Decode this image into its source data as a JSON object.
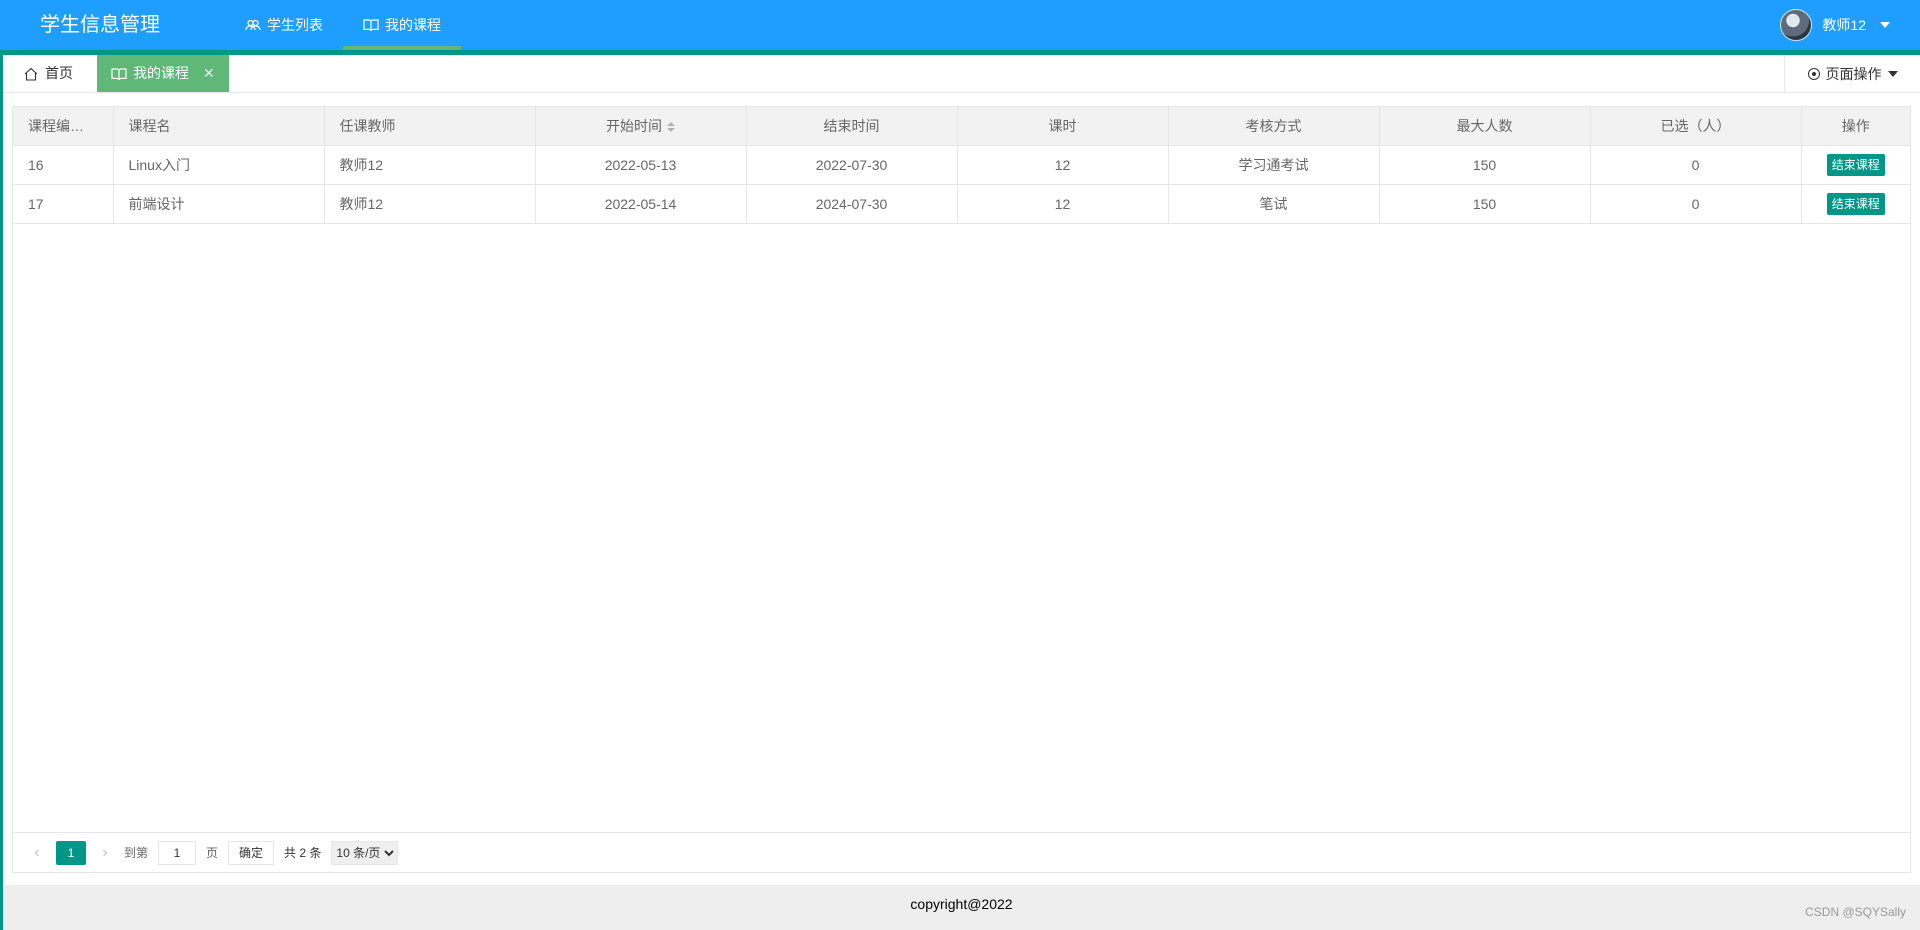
{
  "header": {
    "logo": "学生信息管理",
    "nav": [
      {
        "label": "学生列表",
        "icon": "users-icon"
      },
      {
        "label": "我的课程",
        "icon": "book-icon",
        "active": true
      }
    ],
    "user_name": "教师12"
  },
  "tabs": {
    "home": "首页",
    "active": "我的课程",
    "close": "✕",
    "page_ops": "页面操作"
  },
  "table": {
    "columns": [
      "课程编号...",
      "课程名",
      "任课教师",
      "开始时间",
      "结束时间",
      "课时",
      "考核方式",
      "最大人数",
      "已选（人）",
      "操作"
    ],
    "rows": [
      {
        "id": "16",
        "name": "Linux入门",
        "teacher": "教师12",
        "start": "2022-05-13",
        "end": "2022-07-30",
        "hours": "12",
        "exam": "学习通考试",
        "max": "150",
        "selected": "0",
        "action": "结束课程"
      },
      {
        "id": "17",
        "name": "前端设计",
        "teacher": "教师12",
        "start": "2022-05-14",
        "end": "2024-07-30",
        "hours": "12",
        "exam": "笔试",
        "max": "150",
        "selected": "0",
        "action": "结束课程"
      }
    ]
  },
  "pager": {
    "current": "1",
    "goto_label": "到第",
    "goto_value": "1",
    "page_unit": "页",
    "confirm": "确定",
    "total": "共 2 条",
    "page_size": "10 条/页"
  },
  "footer": {
    "copyright": "copyright@2022",
    "watermark": "CSDN @SQYSally"
  },
  "colors": {
    "header": "#1E9FFF",
    "accent": "#009688",
    "tab_active": "#5FB878"
  }
}
